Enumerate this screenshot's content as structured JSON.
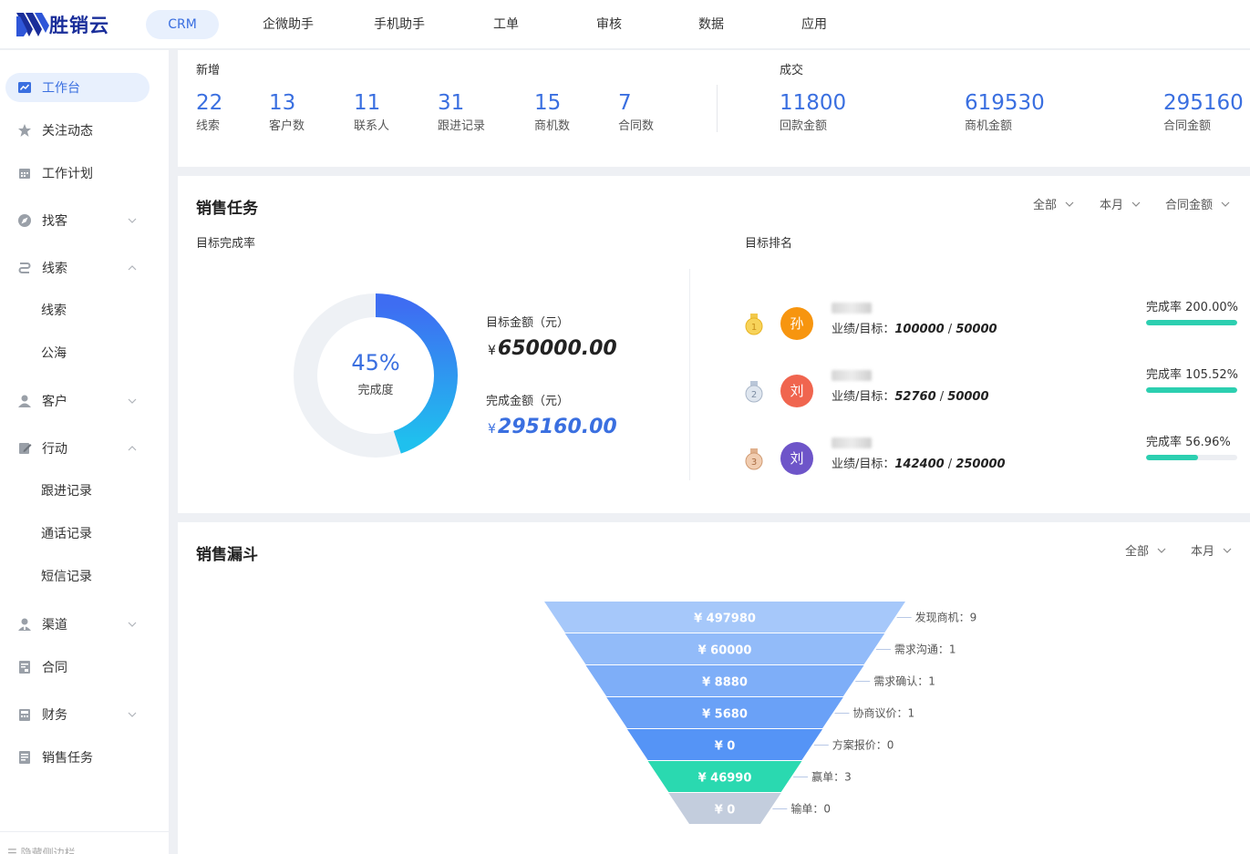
{
  "brand": {
    "name": "胜销云"
  },
  "nav": [
    "CRM",
    "企微助手",
    "手机助手",
    "工单",
    "审核",
    "数据",
    "应用"
  ],
  "sidebar": {
    "items": [
      {
        "label": "工作台",
        "icon": "chart-line-icon",
        "active": true
      },
      {
        "label": "关注动态",
        "icon": "star-icon"
      },
      {
        "label": "工作计划",
        "icon": "calendar-icon"
      },
      {
        "label": "找客",
        "icon": "compass-icon",
        "expandable": true
      },
      {
        "label": "线索",
        "icon": "route-icon",
        "expanded": true,
        "children": [
          "线索",
          "公海"
        ]
      },
      {
        "label": "客户",
        "icon": "user-icon",
        "expandable": true
      },
      {
        "label": "行动",
        "icon": "edit-icon",
        "expanded": true,
        "children": [
          "跟进记录",
          "通话记录",
          "短信记录"
        ]
      },
      {
        "label": "渠道",
        "icon": "agent-icon",
        "expandable": true
      },
      {
        "label": "合同",
        "icon": "contract-icon"
      },
      {
        "label": "财务",
        "icon": "finance-icon",
        "expandable": true
      },
      {
        "label": "销售任务",
        "icon": "task-icon"
      }
    ],
    "footer": "隐藏侧边栏"
  },
  "stats": {
    "new_label": "新增",
    "deal_label": "成交",
    "new_items": [
      {
        "value": "22",
        "label": "线索"
      },
      {
        "value": "13",
        "label": "客户数"
      },
      {
        "value": "11",
        "label": "联系人"
      },
      {
        "value": "31",
        "label": "跟进记录"
      },
      {
        "value": "15",
        "label": "商机数"
      },
      {
        "value": "7",
        "label": "合同数"
      }
    ],
    "deal_items": [
      {
        "value": "11800",
        "label": "回款金额"
      },
      {
        "value": "619530",
        "label": "商机金额"
      },
      {
        "value": "295160",
        "label": "合同金额"
      }
    ]
  },
  "task": {
    "title": "销售任务",
    "filters": [
      "全部",
      "本月",
      "合同金额"
    ],
    "completion_label": "目标完成率",
    "ranking_label": "目标排名",
    "completion_pct": 45,
    "completion_text": "45%",
    "completion_sub": "完成度",
    "target_label": "目标金额（元）",
    "target_value": "650000.00",
    "done_label": "完成金额（元）",
    "done_value": "295160.00",
    "currency": "¥",
    "ranking": [
      {
        "rank": 1,
        "avatar": "孙",
        "color": "#f7950f",
        "perf_prefix": "业绩/目标：",
        "perf": "100000",
        "target": "50000",
        "rate_text": "完成率 200.00%",
        "rate": 1.0
      },
      {
        "rank": 2,
        "avatar": "刘",
        "color": "#f0654f",
        "perf_prefix": "业绩/目标：",
        "perf": "52760",
        "target": "50000",
        "rate_text": "完成率 105.52%",
        "rate": 1.0
      },
      {
        "rank": 3,
        "avatar": "刘",
        "color": "#6e55c9",
        "perf_prefix": "业绩/目标：",
        "perf": "142400",
        "target": "250000",
        "rate_text": "完成率 56.96%",
        "rate": 0.5696
      }
    ]
  },
  "funnel": {
    "title": "销售漏斗",
    "filters": [
      "全部",
      "本月"
    ],
    "stages": [
      {
        "value": "¥ 497980",
        "label": "发现商机：9",
        "color": "#a6c8fa"
      },
      {
        "value": "¥ 60000",
        "label": "需求沟通：1",
        "color": "#92bbf9"
      },
      {
        "value": "¥ 8880",
        "label": "需求确认：1",
        "color": "#7eaef8"
      },
      {
        "value": "¥ 5680",
        "label": "协商议价：1",
        "color": "#6aa1f7"
      },
      {
        "value": "¥ 0",
        "label": "方案报价：0",
        "color": "#5594f6"
      },
      {
        "value": "¥ 46990",
        "label": "赢单：3",
        "color": "#2ad9b0"
      },
      {
        "value": "¥ 0",
        "label": "输单：0",
        "color": "#c3cddd"
      }
    ]
  }
}
